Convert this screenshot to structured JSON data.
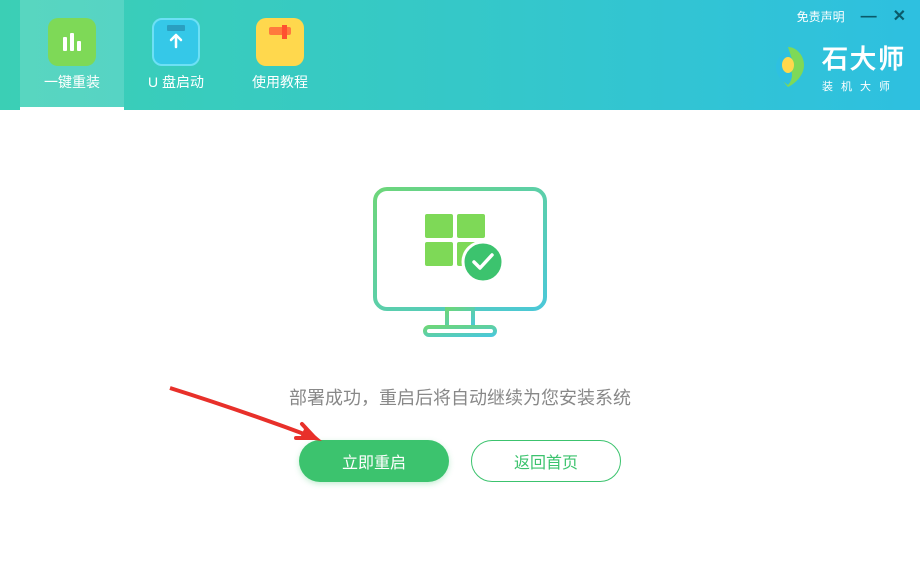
{
  "header": {
    "tabs": [
      {
        "label": "一键重装",
        "icon": "reinstall"
      },
      {
        "label": "U 盘启动",
        "icon": "usb-boot"
      },
      {
        "label": "使用教程",
        "icon": "tutorial"
      }
    ],
    "disclaimer": "免责声明",
    "brand": {
      "title": "石大师",
      "subtitle": "装机大师"
    }
  },
  "content": {
    "message": "部署成功，重启后将自动继续为您安装系统",
    "primary_button": "立即重启",
    "secondary_button": "返回首页"
  },
  "colors": {
    "accent_green": "#3cc36e",
    "header_gradient_start": "#3bcfb5",
    "header_gradient_end": "#2ec0e0"
  }
}
